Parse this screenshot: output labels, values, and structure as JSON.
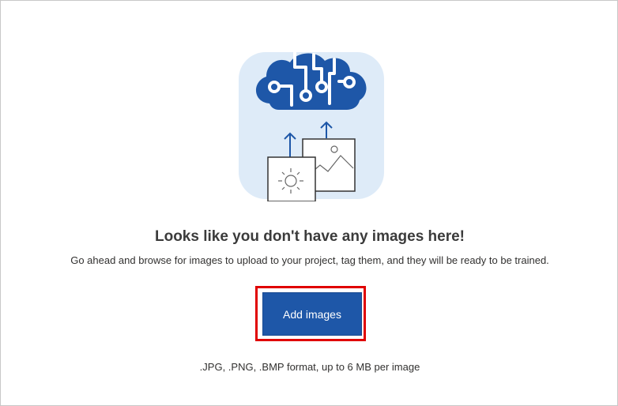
{
  "empty_state": {
    "heading": "Looks like you don't have any images here!",
    "description": "Go ahead and browse for images to upload to your project, tag them, and they will be ready to be trained.",
    "add_button_label": "Add images",
    "formats_note": ".JPG, .PNG, .BMP format, up to 6 MB per image"
  },
  "colors": {
    "accent": "#1e57a8",
    "illustration_bg": "#deebf8",
    "highlight_border": "#e00000",
    "heading_text": "#3b3b3b",
    "body_text": "#323130"
  },
  "icons": {
    "illustration": "ai-cloud-upload-illustration"
  }
}
